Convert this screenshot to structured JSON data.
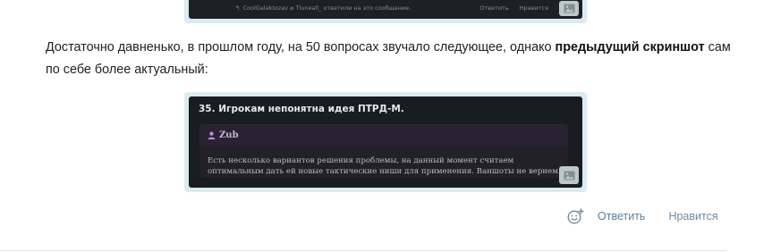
{
  "top_screenshot": {
    "reply_notice": "CoolGalaktozav и Tluneall_ ответили на это сообщение.",
    "reply_label": "Ответить",
    "like_label": "Нравится"
  },
  "post": {
    "text_before_bold": "Достаточно давненько, в прошлом году, на 50 вопросах звучало следующее, однако ",
    "bold_text": "предыдущий скриншот",
    "text_after_bold": " сам по себе более актуальный:"
  },
  "main_screenshot": {
    "title": "35. Игрокам непонятна идея ПТРД-М.",
    "quote_author": "Zub",
    "quote_text": "Есть несколько вариантов решения проблемы, на данный момент считаем оптимальным дать ей новые тактические ниши для применения. Ваншоты не вернем."
  },
  "actions": {
    "reply_label": "Ответить",
    "like_label": "Нравится"
  },
  "colors": {
    "link": "#5e7e96",
    "frame": "#dcebf2",
    "author": "#c7b7d6"
  }
}
